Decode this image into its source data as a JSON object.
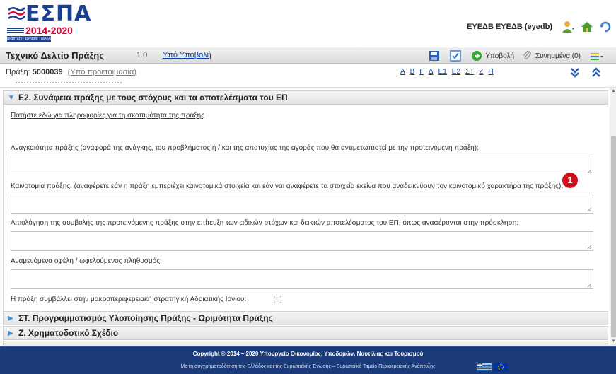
{
  "header": {
    "logo_text": "ΕΣΠΑ",
    "logo_years": "2014-2020",
    "logo_tagline": "ανάπτυξη · εργασία · αλληλεγγύη",
    "user_name": "ΕΥΕΔΒ ΕΥΕΔΒ (eyedb)",
    "icons": [
      "user-icon",
      "home-icon",
      "logout-icon"
    ]
  },
  "titlebar": {
    "title": "Τεχνικό Δελτίο Πράξης",
    "version": "1.0",
    "status": "Υπό Υποβολή",
    "tools": {
      "submit_label": "Υποβολή",
      "attachments_label": "Συνημμένα (0)"
    }
  },
  "subbar": {
    "label": "Πράξη:",
    "code": "5000039",
    "sub_status": "(Υπό προετοιμασία)",
    "letters": [
      "Α",
      "Β",
      "Γ",
      "Δ",
      "Ε1",
      "Ε2",
      "ΣΤ",
      "Ζ",
      "Η"
    ]
  },
  "sections": {
    "e2": {
      "title": "Ε2. Συνάφεια πράξης με τους στόχους και τα αποτελέσματα του ΕΠ",
      "info_link": "Πατήστε εδώ για πληροφορίες για τη σκοπιμότητα της πράξης",
      "fields": [
        {
          "label": "Αναγκαιότητα πράξης (αναφορά της ανάγκης, του προβλήματος ή / και της αποτυχίας της αγοράς που θα αντιμετωπιστεί με την προτεινόμενη πράξη):",
          "value": ""
        },
        {
          "label": "Καινοτομία πράξης: (αναφέρετε εάν η πράξη εμπεριέχει καινοτομικά στοιχεία και εάν ναι αναφέρετε τα στοιχεία εκείνα που αναδεικνύουν τον καινοτομικό χαρακτήρα της πράξης):",
          "value": ""
        },
        {
          "label": "Αιτιολόγηση της συμβολής της προτεινόμενης πράξης στην επίτευξη των ειδικών στόχων και δεικτών αποτελέσματος του ΕΠ, όπως αναφέρονται στην πρόσκληση:",
          "value": ""
        },
        {
          "label": "Αναμενόμενα οφέλη / ωφελούμενος πληθυσμός:",
          "value": ""
        }
      ],
      "checkbox_label": "Η πράξη συμβάλλει στην μακροπεριφερειακή στρατηγική Αδριατικής Ιονίου:",
      "checkbox_checked": false,
      "badge": "1"
    },
    "st": {
      "title": "ΣΤ. Προγραμματισμός Υλοποίησης Πράξης - Ωριμότητα Πράξης"
    },
    "z": {
      "title": "Ζ. Χρηματοδοτικό Σχέδιο"
    }
  },
  "footer": {
    "copyright": "Copyright © 2014 – 2020 Υπουργείο Οικονομίας, Υποδομών, Ναυτιλίας και Τουρισμού",
    "cofunding": "Με τη συγχρηματοδότηση της Ελλάδος και της Ευρωπαϊκής Ένωσης – Ευρωπαϊκό Ταμείο Περιφερειακής Ανάπτυξης"
  },
  "colors": {
    "brand_blue": "#1a3f8f",
    "brand_red": "#e4003a",
    "link_blue": "#0645ad",
    "footer_bg": "#1b3a7a",
    "badge_red": "#d10f1a"
  }
}
